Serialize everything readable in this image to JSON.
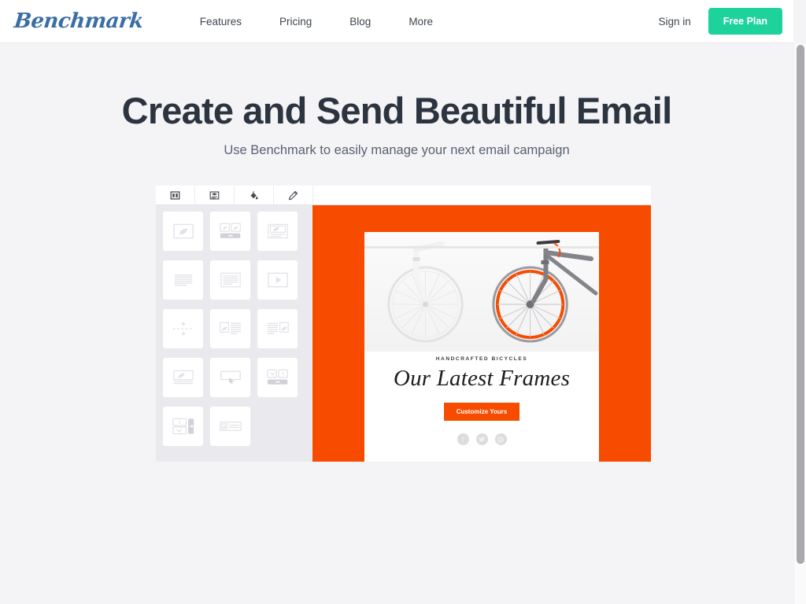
{
  "navbar": {
    "logo": "Benchmark",
    "links": [
      {
        "label": "Features"
      },
      {
        "label": "Pricing"
      },
      {
        "label": "Blog"
      },
      {
        "label": "More"
      }
    ],
    "sign_in": "Sign in",
    "free_plan": "Free Plan",
    "accent_color": "#1ed29b",
    "logo_color": "#3a6ea5"
  },
  "hero": {
    "headline": "Create and Send Beautiful Email",
    "subheadline": "Use Benchmark to easily manage your next email campaign",
    "headline_color": "#2c3440",
    "subhead_color": "#596170",
    "background": "#f4f4f6"
  },
  "editor": {
    "toolbar": [
      {
        "icon": "columns-layout-icon",
        "label": "Layout"
      },
      {
        "icon": "template-content-icon",
        "label": "Content"
      },
      {
        "icon": "paint-bucket-icon",
        "label": "Styles"
      },
      {
        "icon": "pencil-edit-icon",
        "label": "Edit"
      }
    ],
    "palette_blocks": [
      {
        "icon": "image-block-icon"
      },
      {
        "icon": "two-image-button-block-icon"
      },
      {
        "icon": "image-caption-block-icon"
      },
      {
        "icon": "text-lines-block-icon"
      },
      {
        "icon": "text-box-block-icon"
      },
      {
        "icon": "video-block-icon"
      },
      {
        "icon": "divider-block-icon"
      },
      {
        "icon": "image-left-text-right-block-icon"
      },
      {
        "icon": "text-left-image-right-block-icon"
      },
      {
        "icon": "image-text-stack-block-icon"
      },
      {
        "icon": "button-click-block-icon"
      },
      {
        "icon": "social-button-block-icon"
      },
      {
        "icon": "social-stack-block-icon"
      },
      {
        "icon": "thumbnail-text-block-icon"
      }
    ],
    "palette_background": "#eaeaee"
  },
  "email_preview": {
    "frame_color": "#f74b00",
    "eyebrow": "HANDCRAFTED BICYCLES",
    "title": "Our Latest Frames",
    "cta_label": "Customize Yours",
    "cta_color": "#f74b00",
    "socials": [
      {
        "icon": "facebook-icon",
        "glyph": "f"
      },
      {
        "icon": "twitter-icon",
        "glyph": "t"
      },
      {
        "icon": "instagram-icon",
        "glyph": "o"
      }
    ],
    "photo_alt": "Two bicycles, one white and one grey with orange rim"
  }
}
